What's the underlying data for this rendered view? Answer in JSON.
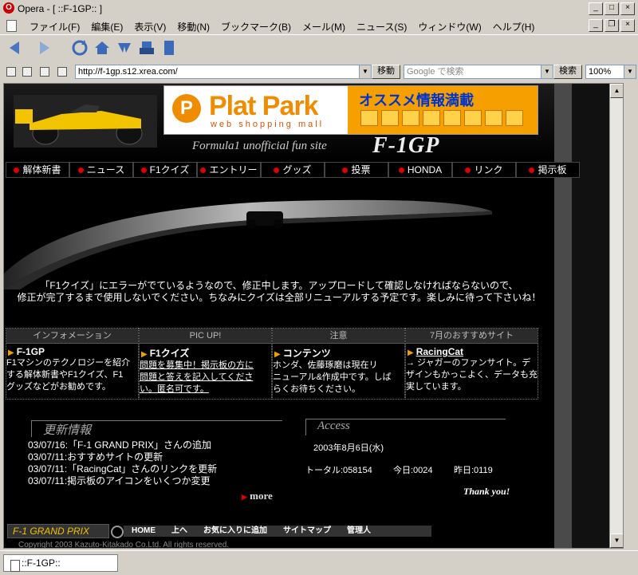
{
  "window": {
    "title": "Opera - [ ::F-1GP:: ]"
  },
  "menu": [
    "ファイル(F)",
    "編集(E)",
    "表示(V)",
    "移動(N)",
    "ブックマーク(B)",
    "メール(M)",
    "ニュース(S)",
    "ウィンドウ(W)",
    "ヘルプ(H)"
  ],
  "address": {
    "url": "http://f-1gp.s12.xrea.com/",
    "go_label": "移動",
    "search_placeholder": "Google で検索",
    "search_label": "検索",
    "zoom": "100%"
  },
  "site": {
    "banner_brand": "Plat Park",
    "banner_sub": "web shopping mall",
    "banner_promo": "オススメ情報満載",
    "tagline": "Formula1 unofficial fun site",
    "name": "F-1GP",
    "nav": [
      "解体新書",
      "ニュース",
      "F1クイズ",
      "エントリー",
      "グッズ",
      "投票",
      "HONDA",
      "リンク",
      "掲示板"
    ],
    "notice_line1": "「F1クイズ」にエラーがでているようなので、修正中します。アップロードして確認しなければならないので、",
    "notice_line2": "修正が完了するまで使用しないでください。ちなみにクイズは全部リニューアルする予定です。楽しみに待って下さいね！",
    "panels": [
      {
        "head": "インフォメーション",
        "title": "F-1GP",
        "lines": [
          "F1マシンのテクノロジーを紹介",
          "する解体新書やF1クイズ、F1",
          "グッズなどがお勧めです。"
        ]
      },
      {
        "head": "PIC UP!",
        "title": "F1クイズ",
        "lines": [
          "問題を募集中！掲示板の方に",
          "問題と答えを記入してくださ",
          "い。匿名可です。"
        ]
      },
      {
        "head": "注意",
        "title": "コンテンツ",
        "lines": [
          "ホンダ、佐藤琢磨は現在リ",
          "ニューアル&作成中です。しば",
          "らくお待ちください。"
        ]
      },
      {
        "head": "7月のおすすめサイト",
        "title": "RacingCat",
        "lines": [
          "→ ジャガーのファンサイト。デ",
          "ザインもかっこよく、データも充",
          "実しています。"
        ]
      }
    ],
    "updates_title": "更新情報",
    "updates": [
      "03/07/16:「F-1 GRAND PRIX」さんの追加",
      "03/07/11:おすすめサイトの更新",
      "03/07/11:「RacingCat」さんのリンクを更新",
      "03/07/11:掲示板のアイコンをいくつか変更"
    ],
    "more": "more",
    "access_title": "Access",
    "access_date": "2003年8月6日(水)",
    "access_total": "トータル:058154",
    "access_today": "今日:0024",
    "access_yesterday": "昨日:0119",
    "thanks": "Thank you!",
    "footer_label": "F-1 GRAND PRIX",
    "footer_links": [
      "HOME",
      "上へ",
      "お気に入りに追加",
      "サイトマップ",
      "管理人"
    ],
    "copyright": "Copyright 2003 Kazuto-Kitakado Co.Ltd. All rights reserved."
  },
  "status": {
    "tab_title": "::F-1GP::"
  }
}
